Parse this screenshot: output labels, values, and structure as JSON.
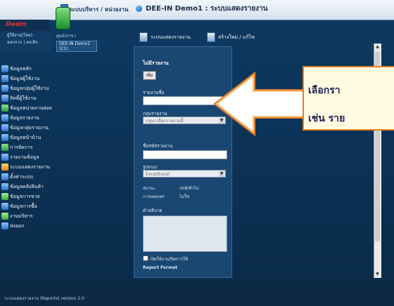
{
  "topbar": {
    "module_label": "ระบบบริหาร / หน่วยงาน",
    "window_title": "DEE-IN Demo1 : ระบบแสดงรายงาน"
  },
  "logo": "DeeIn",
  "user": {
    "line1": "ผู้ใช้งาน(ไทย)",
    "line2": "ออกจาก | ยกเลิก"
  },
  "selection": {
    "label": "ศูนย์/สาขา",
    "value": "DEE-IN Demo1 (C1)"
  },
  "sidebar": {
    "items": [
      {
        "label": "ข้อมูลหลัก"
      },
      {
        "label": "ข้อมูลผู้ใช้งาน"
      },
      {
        "label": "ข้อมูลกลุ่มผู้ใช้งาน"
      },
      {
        "label": "สิทธิ์ผู้ใช้งาน"
      },
      {
        "label": "ข้อมูลหน่วยงานย่อย"
      },
      {
        "label": "ข้อมูลรายงาน"
      },
      {
        "label": "ข้อมูลกลุ่มรายงาน"
      },
      {
        "label": "ข้อมูลหน้าบ้าน"
      },
      {
        "label": "การจัดการ"
      },
      {
        "label": "รายงานข้อมูล"
      },
      {
        "label": "ระบบแสดงรายงาน"
      },
      {
        "label": "ตั้งค่าระบบ"
      },
      {
        "label": "ข้อมูลคลังสินค้า"
      },
      {
        "label": "ข้อมูลการขาย"
      },
      {
        "label": "ข้อมูลการซื้อ"
      },
      {
        "label": "งานบริหาร"
      },
      {
        "label": "ส่งออก"
      }
    ]
  },
  "tabs": [
    {
      "label": "ระบบแสดงรายงาน"
    },
    {
      "label": "สร้างใหม่ / แก้ไข"
    }
  ],
  "form": {
    "heading": "ไม่มีรายงาน",
    "new_button": "เพิ่ม",
    "report_name_label": "รายงานชื่อ",
    "report_group_label": "กลุ่มรายงาน",
    "report_group_placeholder": "กรุณาเลือกรายงานนี้",
    "report_code_label": "ชื่อรหัสรายงาน",
    "format_label": "รูปแบบ",
    "format_value": "Excel/Excel",
    "status_label": "สถานะ",
    "status_value": "ปกติ/ทั่วไป",
    "publish_label": "การเผยแพร่",
    "publish_value": "ไม่ใช่",
    "description_label": "คำอธิบาย",
    "checkbox_label": "เปิดใช้งาน/ปิดการใช้",
    "bottom_label": "Report Format"
  },
  "footer": {
    "text": "ระบบแสดงรายงาน (Reports) version 2.0"
  },
  "callout": {
    "line1": "เลือกรา",
    "line2": "เช่น ราย"
  },
  "colors": {
    "arrow_fill": "#ffffff",
    "arrow_border": "#e67e22",
    "callout_bg": "#fffbe0"
  }
}
